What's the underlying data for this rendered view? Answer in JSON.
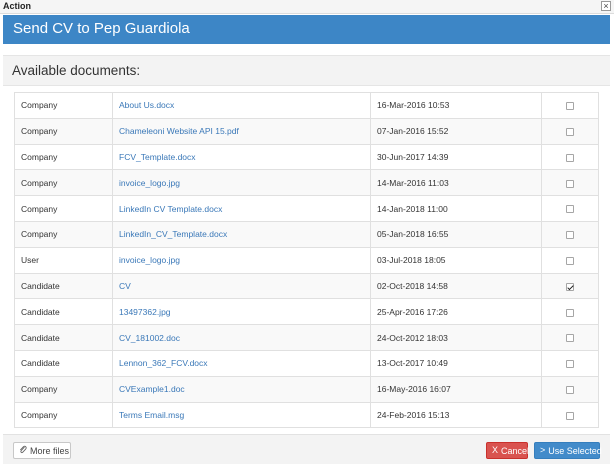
{
  "window": {
    "title": "Action",
    "close_icon": "close-icon"
  },
  "header": {
    "title": "Send CV to Pep Guardiola",
    "color": "#3d86c6"
  },
  "section": {
    "title": "Available documents:"
  },
  "documents": [
    {
      "owner": "Company",
      "name": "About Us.docx",
      "date": "16-Mar-2016 10:53",
      "checked": false
    },
    {
      "owner": "Company",
      "name": "Chameleoni Website API 15.pdf",
      "date": "07-Jan-2016 15:52",
      "checked": false
    },
    {
      "owner": "Company",
      "name": "FCV_Template.docx",
      "date": "30-Jun-2017 14:39",
      "checked": false
    },
    {
      "owner": "Company",
      "name": "invoice_logo.jpg",
      "date": "14-Mar-2016 11:03",
      "checked": false
    },
    {
      "owner": "Company",
      "name": "LinkedIn CV Template.docx",
      "date": "14-Jan-2018 11:00",
      "checked": false
    },
    {
      "owner": "Company",
      "name": "LinkedIn_CV_Template.docx",
      "date": "05-Jan-2018 16:55",
      "checked": false
    },
    {
      "owner": "User",
      "name": "invoice_logo.jpg",
      "date": "03-Jul-2018 18:05",
      "checked": false
    },
    {
      "owner": "Candidate",
      "name": "CV",
      "date": "02-Oct-2018 14:58",
      "checked": true
    },
    {
      "owner": "Candidate",
      "name": "13497362.jpg",
      "date": "25-Apr-2016 17:26",
      "checked": false
    },
    {
      "owner": "Candidate",
      "name": "CV_181002.doc",
      "date": "24-Oct-2012 18:03",
      "checked": false
    },
    {
      "owner": "Candidate",
      "name": "Lennon_362_FCV.docx",
      "date": "13-Oct-2017 10:49",
      "checked": false
    },
    {
      "owner": "Company",
      "name": "CVExample1.doc",
      "date": "16-May-2016 16:07",
      "checked": false
    },
    {
      "owner": "Company",
      "name": "Terms Email.msg",
      "date": "24-Feb-2016 15:13",
      "checked": false
    }
  ],
  "footer": {
    "more_files": {
      "label": "More files",
      "icon": "paperclip-icon"
    },
    "cancel": {
      "label": "Cancel",
      "icon": "x-icon",
      "glyph": "X",
      "color": "#d9534f"
    },
    "use_selected": {
      "label": "Use Selected",
      "icon": "chevron-right-icon",
      "glyph": ">",
      "color": "#428bca"
    }
  }
}
